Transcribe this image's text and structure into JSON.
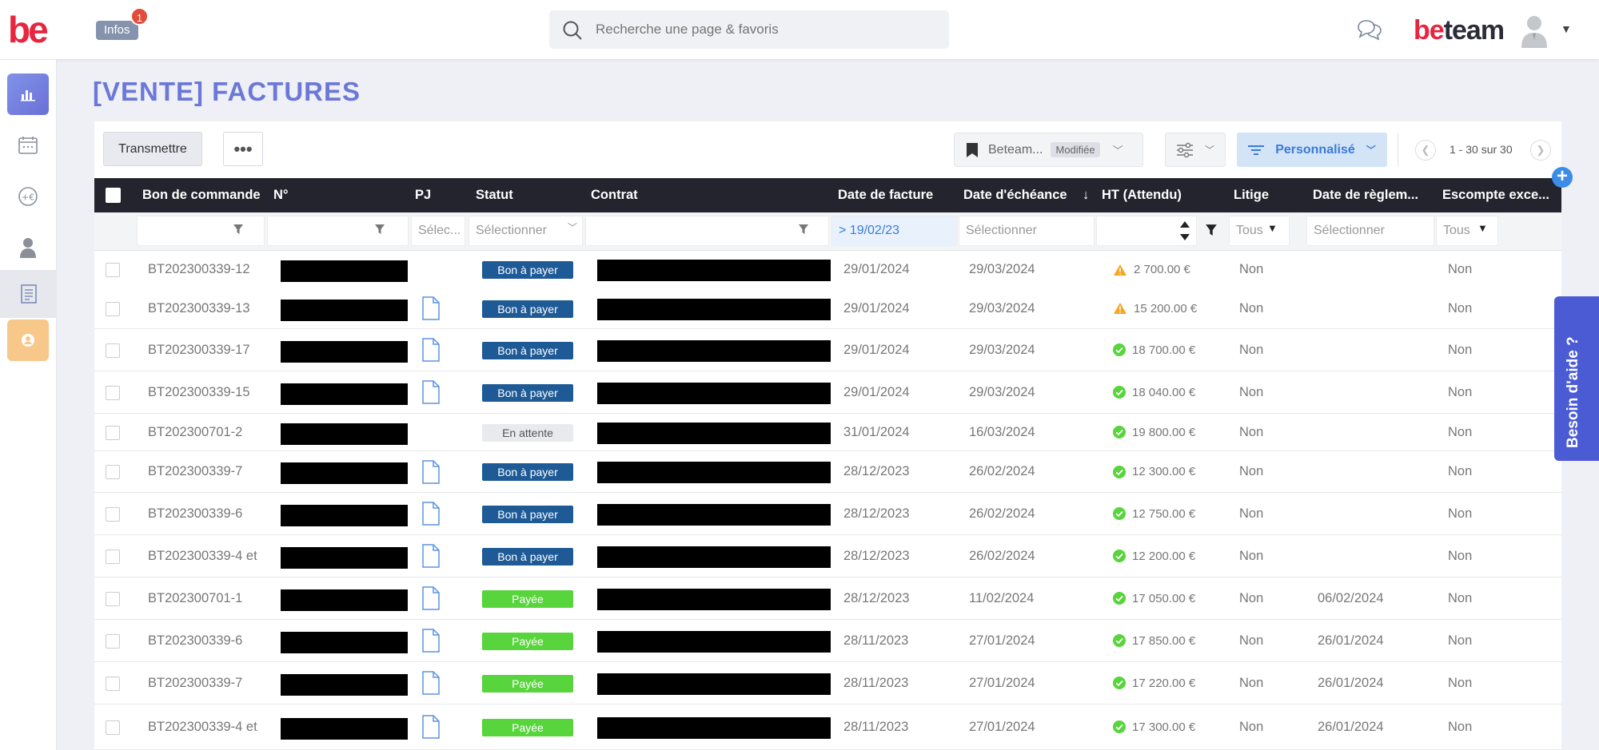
{
  "app": {
    "logo": "be",
    "infos_label": "Infos",
    "infos_badge": "1",
    "search_placeholder": "Recherche une page & favoris",
    "brand_be": "be",
    "brand_team": "team",
    "help_label": "Besoin d'aide ?"
  },
  "sidebar": {
    "items": [
      {
        "icon": "chart-bars-icon",
        "active": true
      },
      {
        "icon": "calendar-icon"
      },
      {
        "icon": "euro-plus-icon"
      },
      {
        "icon": "user-icon"
      },
      {
        "icon": "invoice-icon",
        "highlighted": true
      },
      {
        "icon": "profile-orange-icon"
      }
    ]
  },
  "page": {
    "title": "[VENTE] FACTURES"
  },
  "toolbar": {
    "transmettre": "Transmettre",
    "more": "•••",
    "view_name": "Beteam...",
    "view_modified": "Modifiée",
    "filter_mode": "Personnalisé",
    "pagination": "1 - 30 sur 30"
  },
  "table": {
    "columns": [
      "Bon de commande",
      "N°",
      "PJ",
      "Statut",
      "Contrat",
      "Date de facture",
      "Date d'échéance",
      "HT (Attendu)",
      "Litige",
      "Date de règlem...",
      "Escompte exce..."
    ],
    "sort_indicator": "↓",
    "filters": {
      "pj": "Sélec...",
      "statut": "Sélectionner",
      "date_facture": "> 19/02/23",
      "date_echeance": "Sélectionner",
      "litige": "Tous",
      "date_reglement": "Sélectionner",
      "escompte": "Tous"
    },
    "rows": [
      {
        "bon": "BT202300339-12",
        "pj": false,
        "statut": "Bon à payer",
        "date_facture": "29/01/2024",
        "date_echeance": "29/03/2024",
        "ht": "2 700.00 €",
        "ht_state": "warning",
        "litige": "Non",
        "date_reglement": "",
        "escompte": "Non"
      },
      {
        "bon": "BT202300339-13",
        "pj": true,
        "statut": "Bon à payer",
        "date_facture": "29/01/2024",
        "date_echeance": "29/03/2024",
        "ht": "15 200.00 €",
        "ht_state": "warning",
        "litige": "Non",
        "date_reglement": "",
        "escompte": "Non"
      },
      {
        "bon": "BT202300339-17",
        "pj": true,
        "statut": "Bon à payer",
        "date_facture": "29/01/2024",
        "date_echeance": "29/03/2024",
        "ht": "18 700.00 €",
        "ht_state": "ok",
        "litige": "Non",
        "date_reglement": "",
        "escompte": "Non"
      },
      {
        "bon": "BT202300339-15",
        "pj": true,
        "statut": "Bon à payer",
        "date_facture": "29/01/2024",
        "date_echeance": "29/03/2024",
        "ht": "18 040.00 €",
        "ht_state": "ok",
        "litige": "Non",
        "date_reglement": "",
        "escompte": "Non"
      },
      {
        "bon": "BT202300701-2",
        "pj": false,
        "statut": "En attente",
        "date_facture": "31/01/2024",
        "date_echeance": "16/03/2024",
        "ht": "19 800.00 €",
        "ht_state": "ok",
        "litige": "Non",
        "date_reglement": "",
        "escompte": "Non"
      },
      {
        "bon": "BT202300339-7",
        "pj": true,
        "statut": "Bon à payer",
        "date_facture": "28/12/2023",
        "date_echeance": "26/02/2024",
        "ht": "12 300.00 €",
        "ht_state": "ok",
        "litige": "Non",
        "date_reglement": "",
        "escompte": "Non"
      },
      {
        "bon": "BT202300339-6",
        "pj": true,
        "statut": "Bon à payer",
        "date_facture": "28/12/2023",
        "date_echeance": "26/02/2024",
        "ht": "12 750.00 €",
        "ht_state": "ok",
        "litige": "Non",
        "date_reglement": "",
        "escompte": "Non"
      },
      {
        "bon": "BT202300339-4 et",
        "pj": true,
        "statut": "Bon à payer",
        "date_facture": "28/12/2023",
        "date_echeance": "26/02/2024",
        "ht": "12 200.00 €",
        "ht_state": "ok",
        "litige": "Non",
        "date_reglement": "",
        "escompte": "Non"
      },
      {
        "bon": "BT202300701-1",
        "pj": true,
        "statut": "Payée",
        "date_facture": "28/12/2023",
        "date_echeance": "11/02/2024",
        "ht": "17 050.00 €",
        "ht_state": "ok",
        "litige": "Non",
        "date_reglement": "06/02/2024",
        "escompte": "Non"
      },
      {
        "bon": "BT202300339-6",
        "pj": true,
        "statut": "Payée",
        "date_facture": "28/11/2023",
        "date_echeance": "27/01/2024",
        "ht": "17 850.00 €",
        "ht_state": "ok",
        "litige": "Non",
        "date_reglement": "26/01/2024",
        "escompte": "Non"
      },
      {
        "bon": "BT202300339-7",
        "pj": true,
        "statut": "Payée",
        "date_facture": "28/11/2023",
        "date_echeance": "27/01/2024",
        "ht": "17 220.00 €",
        "ht_state": "ok",
        "litige": "Non",
        "date_reglement": "26/01/2024",
        "escompte": "Non"
      },
      {
        "bon": "BT202300339-4 et",
        "pj": true,
        "statut": "Payée",
        "date_facture": "28/11/2023",
        "date_echeance": "27/01/2024",
        "ht": "17 300.00 €",
        "ht_state": "ok",
        "litige": "Non",
        "date_reglement": "26/01/2024",
        "escompte": "Non"
      }
    ]
  },
  "colors": {
    "accent": "#6c78d8",
    "status_bon": "#1e5a96",
    "status_paid": "#58d43c",
    "warning": "#f5a623",
    "ok": "#58d43c"
  }
}
